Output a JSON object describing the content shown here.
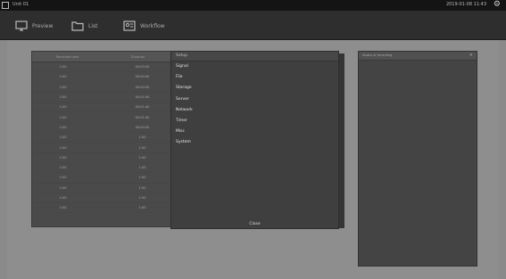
{
  "topbar": {
    "app_name": "Unit 01",
    "clock": "2019-01-08  11:43",
    "gear_icon": "gear-icon"
  },
  "toolbar": {
    "items": [
      {
        "label": "Preview",
        "icon": "monitor-icon"
      },
      {
        "label": "List",
        "icon": "folder-icon"
      },
      {
        "label": "Workflow",
        "icon": "id-card-icon"
      }
    ]
  },
  "table": {
    "headers": [
      "Recorded time",
      "Duration"
    ],
    "rows": [
      [
        "1:00",
        "00:00:00"
      ],
      [
        "1:00",
        "00:00:00"
      ],
      [
        "1:00",
        "00:00:00"
      ],
      [
        "1:00",
        "00:01:00"
      ],
      [
        "1:00",
        "00:01:00"
      ],
      [
        "1:00",
        "00:01:00"
      ],
      [
        "1:00",
        "00:00:00"
      ],
      [
        "1:00",
        "1:00"
      ],
      [
        "1:00",
        "1:00"
      ],
      [
        "1:00",
        "1:00"
      ],
      [
        "1:00",
        "1:00"
      ],
      [
        "1:00",
        "1:00"
      ],
      [
        "1:00",
        "1:00"
      ],
      [
        "1:00",
        "1:00"
      ],
      [
        "1:00",
        "1:00"
      ]
    ]
  },
  "menu": {
    "title": "Setup",
    "items": [
      "Signal",
      "File",
      "Storage",
      "Server",
      "Network",
      "Timer",
      "Misc",
      "System"
    ],
    "close_label": "Close"
  },
  "side_panel": {
    "title": "Status of recording"
  }
}
